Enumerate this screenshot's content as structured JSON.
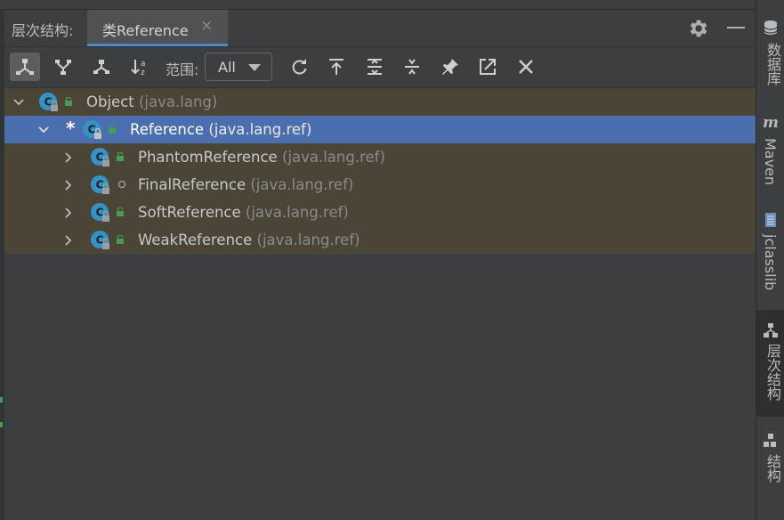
{
  "header": {
    "title": "层次结构:",
    "tab_label": "类Reference",
    "tab_close": "×"
  },
  "toolbar": {
    "buttons": [
      {
        "icon": "subtypes-hierarchy-icon",
        "active": true
      },
      {
        "icon": "supertypes-hierarchy-icon"
      },
      {
        "icon": "class-hierarchy-icon"
      },
      {
        "icon": "sort-alphabetically-icon"
      },
      {
        "icon": "refresh-icon"
      },
      {
        "icon": "export-icon"
      },
      {
        "icon": "expand-all-icon"
      },
      {
        "icon": "collapse-all-icon"
      },
      {
        "icon": "pin-icon"
      },
      {
        "icon": "open-in-new-icon"
      },
      {
        "icon": "close-icon"
      }
    ],
    "scope_label": "范围:",
    "scope_value": "All"
  },
  "tree": {
    "rows": [
      {
        "name": "Object",
        "pkg": "(java.lang)",
        "expanded": true,
        "visibility": "public",
        "locked": true
      },
      {
        "name": "Reference",
        "pkg": "(java.lang.ref)",
        "expanded": true,
        "marked": "*",
        "selected": true,
        "visibility": "public",
        "locked": true
      },
      {
        "name": "PhantomReference",
        "pkg": "(java.lang.ref)",
        "expanded": false,
        "visibility": "public",
        "locked": true
      },
      {
        "name": "FinalReference",
        "pkg": "(java.lang.ref)",
        "expanded": false,
        "visibility": "package",
        "locked": true
      },
      {
        "name": "SoftReference",
        "pkg": "(java.lang.ref)",
        "expanded": false,
        "visibility": "public",
        "locked": true
      },
      {
        "name": "WeakReference",
        "pkg": "(java.lang.ref)",
        "expanded": false,
        "visibility": "public",
        "locked": true
      }
    ]
  },
  "sidebar": {
    "tabs": [
      {
        "label": "数据库",
        "icon": "database-icon"
      },
      {
        "label": "Maven",
        "icon": "maven-icon"
      },
      {
        "label": "jclasslib",
        "icon": "jclasslib-icon"
      },
      {
        "label": "层次结构",
        "icon": "hierarchy-icon",
        "active": true
      },
      {
        "label": "结构",
        "icon": "structure-icon"
      }
    ]
  },
  "colors": {
    "background": "#3c3f41",
    "row_highlight": "#4a4536",
    "selection": "#4b6eaf",
    "accent_tab": "#4a88c7",
    "class_icon": "#3592c4",
    "public_green": "#499c54"
  }
}
